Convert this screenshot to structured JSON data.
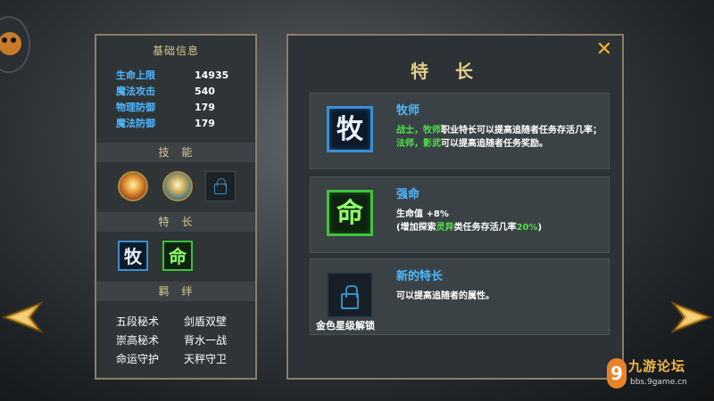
{
  "left_panel": {
    "basic_info_title": "基础信息",
    "stats": [
      {
        "label": "生命上限",
        "value": "14935"
      },
      {
        "label": "魔法攻击",
        "value": "540"
      },
      {
        "label": "物理防御",
        "value": "179"
      },
      {
        "label": "魔法防御",
        "value": "179"
      }
    ],
    "skills_title": "技　能",
    "traits_title": "特　长",
    "trait_icons": [
      "牧",
      "命"
    ],
    "bonds_title": "羁　绊",
    "bonds": [
      "五段秘术",
      "剑盾双壁",
      "崇高秘术",
      "背水一战",
      "命运守护",
      "天秤守卫"
    ]
  },
  "right_panel": {
    "title": "特长",
    "close_symbol": "✕",
    "cards": [
      {
        "icon_char": "牧",
        "name": "牧师",
        "desc_parts": [
          "战士，牧师",
          "职业特长可以提高追随者任务存活几率；",
          "法师，影武",
          "可以提高追随者任务奖励。"
        ]
      },
      {
        "icon_char": "命",
        "name": "强命",
        "desc_line1": "生命值 +8%",
        "desc_parts": [
          "(增加探索",
          "灵异",
          "类任务存活几率",
          "20%",
          ")"
        ]
      },
      {
        "name": "新的特长",
        "desc": "可以提高追随者的属性。",
        "unlock_label": "金色星级解锁"
      }
    ]
  },
  "watermark": {
    "text": "九游论坛",
    "url": "bbs.9game.cn",
    "logo_char": "9"
  },
  "colors": {
    "accent_gold": "#e3cf88",
    "stat_blue": "#4fb7ff",
    "highlight_green": "#4fe04a",
    "panel_border": "#8b8062"
  }
}
